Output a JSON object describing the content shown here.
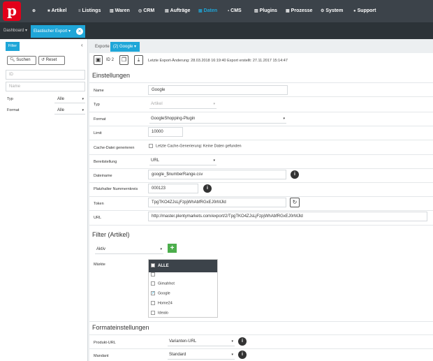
{
  "logo": {
    "glyph": "p"
  },
  "nav": [
    {
      "icon": "⊕",
      "label": ""
    },
    {
      "icon": "■",
      "label": "Artikel"
    },
    {
      "icon": "≡",
      "label": "Listings"
    },
    {
      "icon": "▥",
      "label": "Waren"
    },
    {
      "icon": "◎",
      "label": "CRM"
    },
    {
      "icon": "▤",
      "label": "Aufträge"
    },
    {
      "icon": "▦",
      "label": "Daten"
    },
    {
      "icon": "▪",
      "label": "CMS"
    },
    {
      "icon": "▨",
      "label": "Plugins"
    },
    {
      "icon": "▦",
      "label": "Prozesse"
    },
    {
      "icon": "⚙",
      "label": "System"
    },
    {
      "icon": "●",
      "label": "Support"
    }
  ],
  "tabs": {
    "dashboard": "Dashboard ▾",
    "export": "Elastischer Export ▾",
    "close": "×"
  },
  "left": {
    "filter_tab": "Filter",
    "collapse": "‹",
    "search_btn": "Suchen",
    "reset_btn": "Reset",
    "id_placeholder": "ID",
    "name_placeholder": "Name",
    "typ_label": "Typ",
    "typ_value": "Alle",
    "format_label": "Format",
    "format_value": "Alle"
  },
  "subtabs": {
    "exporte": "Exporte",
    "google": "(2) Google ▾"
  },
  "toolbar": {
    "id_label": "ID 2",
    "status": "Letzte Export-Änderung: 28.03.2018 16:19:40  Export erstellt: 27.11.2017 15:14:47"
  },
  "settings": {
    "title": "Einstellungen",
    "name_label": "Name",
    "name_value": "Google",
    "typ_label": "Typ",
    "typ_value": "Artikel",
    "format_label": "Format",
    "format_value": "GoogleShopping-Plugin",
    "limit_label": "Limit",
    "limit_value": "10000",
    "cache_label": "Cache-Datei generieren",
    "cache_value": "Letzte Cache-Generierung: Keine Daten gefunden",
    "bereit_label": "Bereitstellung",
    "bereit_value": "URL",
    "datei_label": "Dateiname",
    "datei_value": "google_$numberRange.csv",
    "platz_label": "Platzhalter Nummernkreis",
    "platz_value": "000123",
    "token_label": "Token",
    "token_value": "TpgTKO4ZJsLjFzpjWhAbfRGxEJ0rMJld",
    "url_label": "URL",
    "url_value": "http://master.plentymarkets.com/export/2/TpgTKO4ZJsLjFzpjWhAbfRGxEJ0rMJld"
  },
  "filter": {
    "title": "Filter (Artikel)",
    "select_value": "Aktiv",
    "add": "+",
    "markets_label": "Märkte",
    "markets_header": "ALLE",
    "markets": [
      {
        "label": "",
        "checked": false
      },
      {
        "label": "Gimahhot",
        "checked": false
      },
      {
        "label": "Google",
        "checked": true
      },
      {
        "label": "Home24",
        "checked": false
      },
      {
        "label": "Idealo",
        "checked": false
      }
    ]
  },
  "format": {
    "title": "Formateinstellungen",
    "produkt_label": "Produkt-URL",
    "produkt_value": "Varianten-URL",
    "mandant_label": "Mandant",
    "mandant_value": "Standard"
  },
  "icons": {
    "info": "i",
    "refresh": "↻",
    "check": "✓",
    "caret": "▾"
  },
  "colors": {
    "accent": "#1fa6d8",
    "topbar": "#3c434a",
    "logo": "#e2001a",
    "add": "#4cae4c"
  }
}
